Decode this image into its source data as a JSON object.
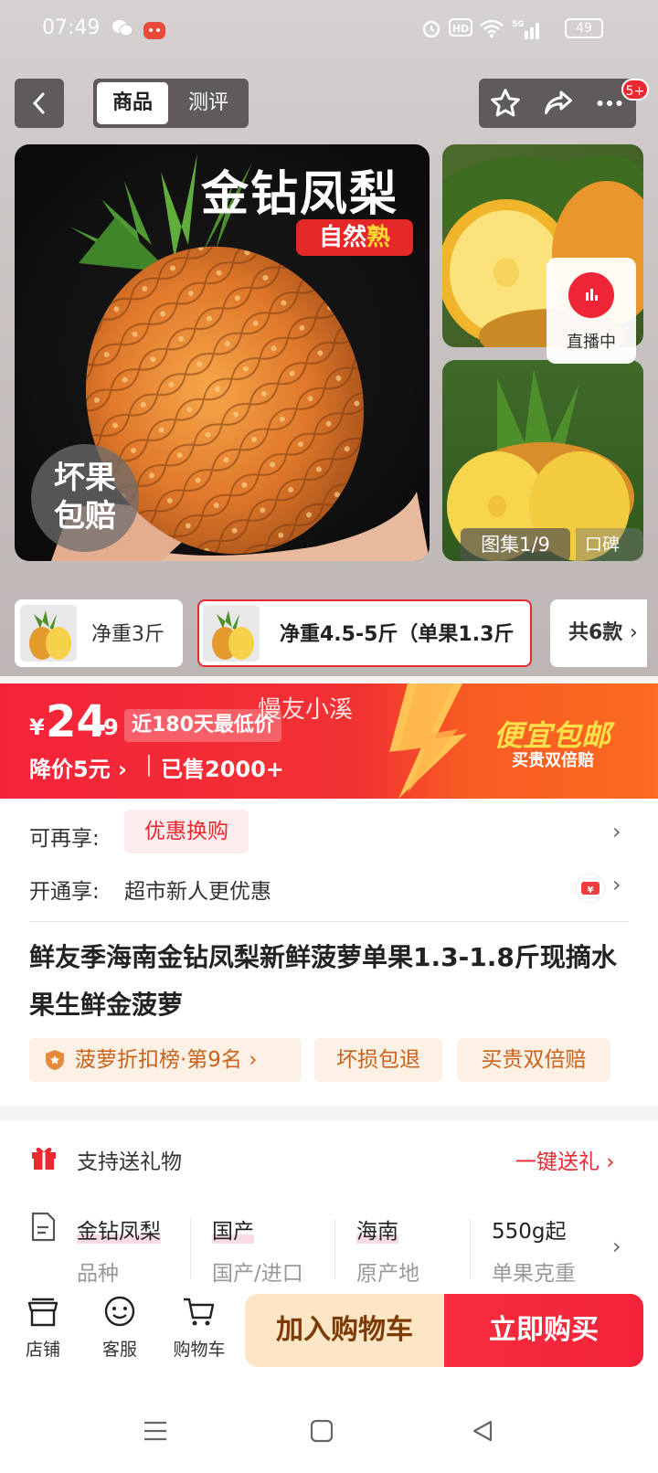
{
  "status_bar": {
    "time": "07:49",
    "battery": "49",
    "network": "5G"
  },
  "nav": {
    "tab_product": "商品",
    "tab_review": "测评",
    "badge": "5+"
  },
  "gallery": {
    "title_overlay": "金钻凤梨",
    "natural_badge_a": "自然",
    "natural_badge_b": "熟",
    "guarantee_line1": "坏果",
    "guarantee_line2": "包赔",
    "live_label": "直播中",
    "counter": "图集1/9",
    "word_of_mouth": "口碑"
  },
  "variants": {
    "items": [
      {
        "label": "净重3斤"
      },
      {
        "label": "净重4.5-5斤（单果1.3斤"
      }
    ],
    "more": "共6款"
  },
  "price": {
    "currency": "¥",
    "integer": "24",
    "decimal": ".9",
    "low_badge": "近180天最低价",
    "watermark": "慢友小溪",
    "price_drop": "降价5元 ›",
    "sold": "已售2000+",
    "promo_title": "便宜包邮",
    "promo_sub": "买贵双倍赔"
  },
  "offers": {
    "rebuy_label": "可再享:",
    "rebuy_tag": "优惠换购",
    "open_label": "开通享:",
    "open_text": "超市新人更优惠"
  },
  "product": {
    "title": "鲜友季海南金钻凤梨新鲜菠萝单果1.3-1.8斤现摘水果生鲜金菠萝",
    "tags": {
      "rank": "菠萝折扣榜·第9名 ›",
      "return": "坏损包退",
      "double": "买贵双倍赔"
    }
  },
  "gift": {
    "label": "支持送礼物",
    "action": "一键送礼 ›"
  },
  "params": [
    {
      "value": "金钻凤梨",
      "key": "品种"
    },
    {
      "value": "国产",
      "key": "国产/进口"
    },
    {
      "value": "海南",
      "key": "原产地"
    },
    {
      "value": "550g起",
      "key": "单果克重"
    }
  ],
  "bottom_bar": {
    "store": "店铺",
    "service": "客服",
    "cart": "购物车",
    "add_cart": "加入购物车",
    "buy_now": "立即购买"
  },
  "colors": {
    "accent": "#e8292f",
    "promo_yellow": "#ffe04a",
    "tag_orange": "#c9631b"
  }
}
